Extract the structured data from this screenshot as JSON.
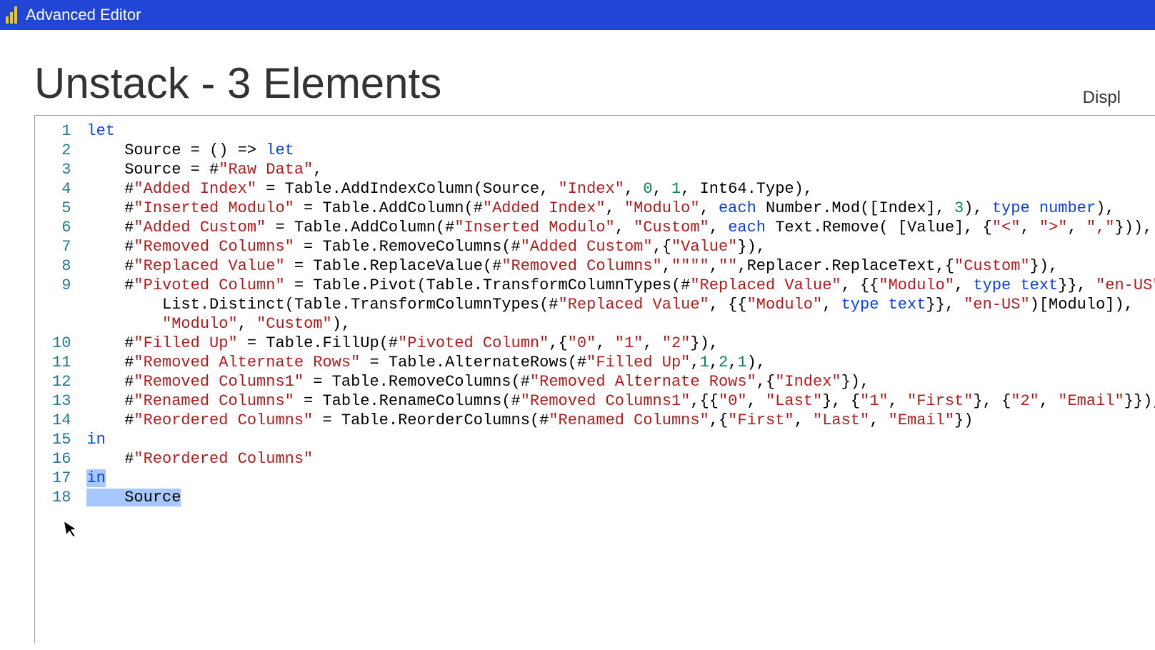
{
  "titleBar": {
    "appTitle": "Advanced Editor"
  },
  "queryName": "Unstack - 3 Elements",
  "displayOptions": "Displ",
  "lineNumbers": [
    "1",
    "2",
    "3",
    "4",
    "5",
    "6",
    "7",
    "8",
    "9",
    "10",
    "11",
    "12",
    "13",
    "14",
    "15",
    "16",
    "17",
    "18"
  ],
  "code": {
    "l1": {
      "a": "let"
    },
    "l2": {
      "a": "    Source = () => ",
      "b": "let"
    },
    "l3": {
      "a": "    Source = #",
      "b": "\"Raw Data\"",
      "c": ","
    },
    "l4": {
      "a": "    #",
      "b": "\"Added Index\"",
      "c": " = Table.AddIndexColumn(Source, ",
      "d": "\"Index\"",
      "e": ", ",
      "f": "0",
      "g": ", ",
      "h": "1",
      "i": ", Int64.Type),"
    },
    "l5": {
      "a": "    #",
      "b": "\"Inserted Modulo\"",
      "c": " = Table.AddColumn(#",
      "d": "\"Added Index\"",
      "e": ", ",
      "f": "\"Modulo\"",
      "g": ", ",
      "h": "each",
      "i": " Number.Mod([Index], ",
      "j": "3",
      "k": "), ",
      "l": "type number",
      "m": "),"
    },
    "l6": {
      "a": "    #",
      "b": "\"Added Custom\"",
      "c": " = Table.AddColumn(#",
      "d": "\"Inserted Modulo\"",
      "e": ", ",
      "f": "\"Custom\"",
      "g": ", ",
      "h": "each",
      "i": " Text.Remove( [Value], {",
      "j": "\"<\"",
      "k": ", ",
      "l": "\">\"",
      "m": ", ",
      "n": "\",\"",
      "o": "})),"
    },
    "l7": {
      "a": "    #",
      "b": "\"Removed Columns\"",
      "c": " = Table.RemoveColumns(#",
      "d": "\"Added Custom\"",
      "e": ",{",
      "f": "\"Value\"",
      "g": "}),"
    },
    "l8": {
      "a": "    #",
      "b": "\"Replaced Value\"",
      "c": " = Table.ReplaceValue(#",
      "d": "\"Removed Columns\"",
      "e": ",",
      "f": "\"\"\"\"",
      "g": ",",
      "h": "\"\"",
      "i": ",Replacer.ReplaceText,{",
      "j": "\"Custom\"",
      "k": "}),"
    },
    "l9a": {
      "a": "    #",
      "b": "\"Pivoted Column\"",
      "c": " = Table.Pivot(Table.TransformColumnTypes(#",
      "d": "\"Replaced Value\"",
      "e": ", {{",
      "f": "\"Modulo\"",
      "g": ", ",
      "h": "type text",
      "i": "}}, ",
      "j": "\"en-US\"",
      "k": "),"
    },
    "l9b": {
      "a": "        List.Distinct(Table.TransformColumnTypes(#",
      "b": "\"Replaced Value\"",
      "c": ", {{",
      "d": "\"Modulo\"",
      "e": ", ",
      "f": "type text",
      "g": "}}, ",
      "h": "\"en-US\"",
      "i": ")[Modulo]),"
    },
    "l9c": {
      "a": "        ",
      "b": "\"Modulo\"",
      "c": ", ",
      "d": "\"Custom\"",
      "e": "),"
    },
    "l10": {
      "a": "    #",
      "b": "\"Filled Up\"",
      "c": " = Table.FillUp(#",
      "d": "\"Pivoted Column\"",
      "e": ",{",
      "f": "\"0\"",
      "g": ", ",
      "h": "\"1\"",
      "i": ", ",
      "j": "\"2\"",
      "k": "}),"
    },
    "l11": {
      "a": "    #",
      "b": "\"Removed Alternate Rows\"",
      "c": " = Table.AlternateRows(#",
      "d": "\"Filled Up\"",
      "e": ",",
      "f": "1",
      "g": ",",
      "h": "2",
      "i": ",",
      "j": "1",
      "k": "),"
    },
    "l12": {
      "a": "    #",
      "b": "\"Removed Columns1\"",
      "c": " = Table.RemoveColumns(#",
      "d": "\"Removed Alternate Rows\"",
      "e": ",{",
      "f": "\"Index\"",
      "g": "}),"
    },
    "l13": {
      "a": "    #",
      "b": "\"Renamed Columns\"",
      "c": " = Table.RenameColumns(#",
      "d": "\"Removed Columns1\"",
      "e": ",{{",
      "f": "\"0\"",
      "g": ", ",
      "h": "\"Last\"",
      "i": "}, {",
      "j": "\"1\"",
      "k": ", ",
      "l": "\"First\"",
      "m": "}, {",
      "n": "\"2\"",
      "o": ", ",
      "p": "\"Email\"",
      "q": "}}),"
    },
    "l14": {
      "a": "    #",
      "b": "\"Reordered Columns\"",
      "c": " = Table.ReorderColumns(#",
      "d": "\"Renamed Columns\"",
      "e": ",{",
      "f": "\"First\"",
      "g": ", ",
      "h": "\"Last\"",
      "i": ", ",
      "j": "\"Email\"",
      "k": "})"
    },
    "l15": {
      "a": "in"
    },
    "l16": {
      "a": "    #",
      "b": "\"Reordered Columns\""
    },
    "l17": {
      "a": "in"
    },
    "l18": {
      "a": "    Source"
    }
  }
}
